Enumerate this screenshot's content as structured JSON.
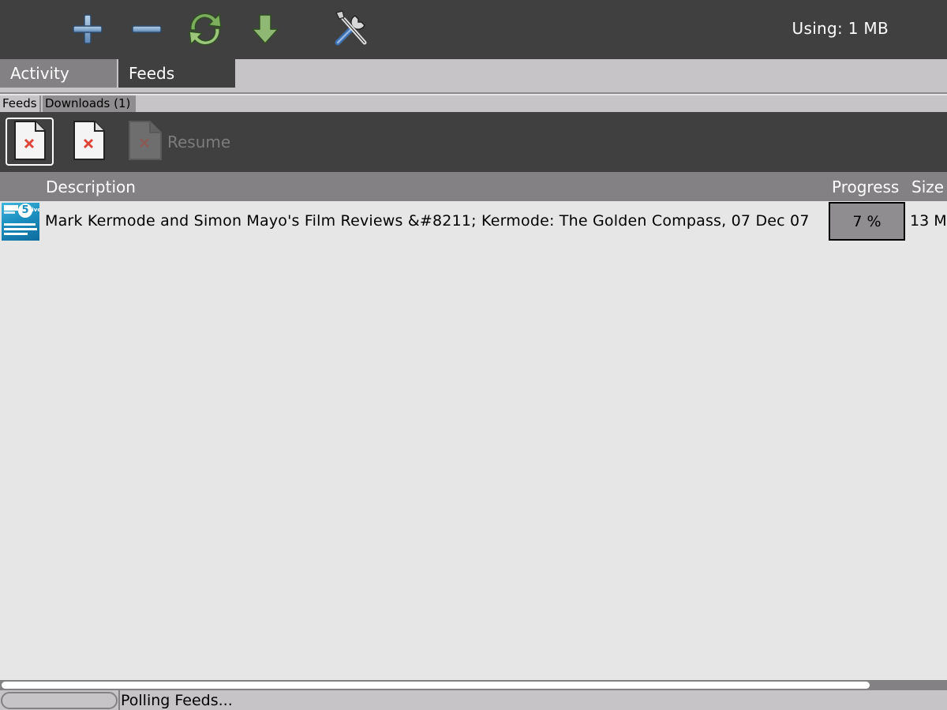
{
  "toolbar": {
    "buttons": [
      {
        "name": "add-feed",
        "icon": "plus-icon"
      },
      {
        "name": "remove-feed",
        "icon": "minus-icon"
      },
      {
        "name": "refresh-feeds",
        "icon": "refresh-icon"
      },
      {
        "name": "download",
        "icon": "down-arrow-icon"
      },
      {
        "name": "settings",
        "icon": "tools-icon"
      }
    ],
    "storage_used": "Using: 1 MB"
  },
  "main_tabs": [
    {
      "label": "Activity",
      "active": false
    },
    {
      "label": "Feeds",
      "active": true
    }
  ],
  "sub_tabs": [
    {
      "label": "Feeds",
      "active": false
    },
    {
      "label": "Downloads (1)",
      "active": true
    }
  ],
  "actions": {
    "cancel_label": "",
    "cancel_all_label": "",
    "resume_label": "Resume",
    "resume_enabled": false
  },
  "columns": {
    "description": "Description",
    "progress": "Progress",
    "size": "Size"
  },
  "downloads": [
    {
      "thumbnail_icon": "bbc-5-live-podcast-thumbnail",
      "description": "Mark Kermode and Simon Mayo's Film Reviews &#8211; Kermode: The Golden Compass, 07 Dec 07",
      "progress_percent": 7,
      "progress_label": "7 %",
      "size": "13 M"
    }
  ],
  "scrollbar": {
    "horizontal_visible_fraction": 0.92
  },
  "status": {
    "text": "Polling Feeds..."
  },
  "colors": {
    "toolbar_bg": "#404040",
    "tab_inactive": "#838183",
    "tab_bar": "#c6c4c6",
    "content_bg": "#e6e6e6",
    "accent_green": "#6a9a50",
    "accent_blue": "#7fa6cc"
  }
}
